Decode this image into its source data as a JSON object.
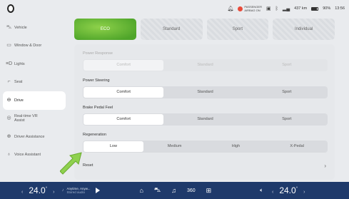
{
  "status": {
    "airbag_line1": "PASSENGER",
    "airbag_line2": "AIRBAG ON",
    "range": "437 km",
    "battery": "90%",
    "time": "13:56"
  },
  "sidebar": {
    "items": [
      {
        "label": "Vehicle",
        "icon": "car-icon"
      },
      {
        "label": "Window & Door",
        "icon": "window-icon"
      },
      {
        "label": "Lights",
        "icon": "lights-icon"
      },
      {
        "label": "Seat",
        "icon": "seat-icon"
      },
      {
        "label": "Drive",
        "icon": "steering-wheel-icon"
      },
      {
        "label": "Real-time VR Assist",
        "icon": "vr-icon"
      },
      {
        "label": "Driver Assistance",
        "icon": "driver-assist-icon"
      },
      {
        "label": "Voice Assistant",
        "icon": "voice-icon"
      }
    ],
    "active_index": 4
  },
  "modes": [
    "ECO",
    "Standard",
    "Sport",
    "Individual"
  ],
  "settings": {
    "power_response": {
      "label": "Power Response",
      "options": [
        "Comfort",
        "Standard",
        "Sport"
      ],
      "selected": "Comfort"
    },
    "power_steering": {
      "label": "Power Steering",
      "options": [
        "Comfort",
        "Standard",
        "Sport"
      ],
      "selected": "Comfort"
    },
    "brake_feel": {
      "label": "Brake Pedal Feel",
      "options": [
        "Comfort",
        "Standard",
        "Sport"
      ],
      "selected": "Comfort"
    },
    "regeneration": {
      "label": "Regeneration",
      "options": [
        "Low",
        "Medium",
        "High",
        "X-Pedal"
      ],
      "selected": "Low"
    },
    "reset_label": "Reset"
  },
  "bottom": {
    "temp_left": "24.0",
    "temp_right": "24.0",
    "unit": "°",
    "media_line1": "Anytime, Anyw...",
    "media_line2": "Stored audio",
    "icon_360": "360"
  },
  "colors": {
    "accent_green": "#5cb531",
    "bottom_bar": "#1f3a6b",
    "airbag_red": "#e84b3a"
  }
}
